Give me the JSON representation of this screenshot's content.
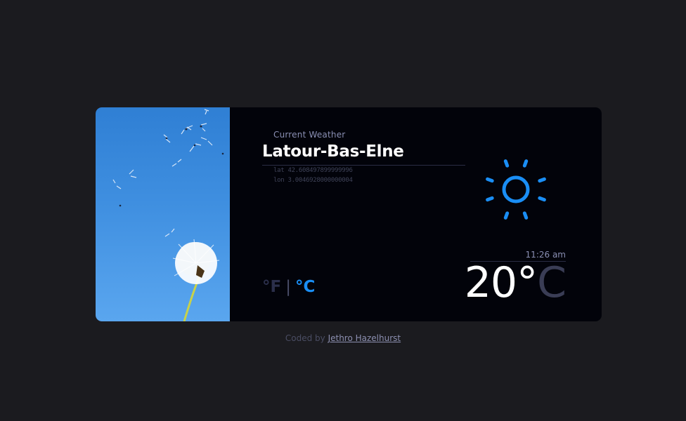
{
  "weather": {
    "heading": "Current Weather",
    "city": "Latour-Bas-Elne",
    "lat": "lat 42.608497899999996",
    "lon": "lon 3.0046928000000004",
    "time": "11:26 am",
    "temperature": "20",
    "degree_symbol": "°",
    "temperature_unit": "C",
    "unit_options": [
      "°F",
      "°C"
    ],
    "unit_separator": "|",
    "selected_unit": "°C",
    "icon": "sun-icon",
    "accent_color": "#1a8ef5"
  },
  "footer": {
    "prefix": "Coded by",
    "author": "Jethro Hazelhurst"
  }
}
